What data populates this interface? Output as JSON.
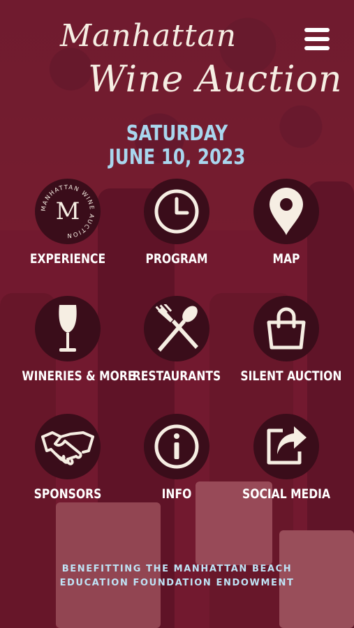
{
  "logo": {
    "line1": "Manhattan",
    "line2": "Wine Auction"
  },
  "event_date": {
    "weekday": "SATURDAY",
    "date": "JUNE 10, 2023"
  },
  "badge": {
    "ring_text": "MANHATTAN WINE AUCTION",
    "letter": "M"
  },
  "grid": [
    {
      "label": "EXPERIENCE",
      "icon": "wine-auction-badge-icon"
    },
    {
      "label": "PROGRAM",
      "icon": "clock-icon"
    },
    {
      "label": "MAP",
      "icon": "map-pin-icon"
    },
    {
      "label": "WINERIES & MORE",
      "icon": "wine-glass-icon"
    },
    {
      "label": "RESTAURANTS",
      "icon": "fork-spoon-icon"
    },
    {
      "label": "SILENT AUCTION",
      "icon": "shopping-bag-icon"
    },
    {
      "label": "SPONSORS",
      "icon": "handshake-icon"
    },
    {
      "label": "INFO",
      "icon": "info-icon"
    },
    {
      "label": "SOCIAL MEDIA",
      "icon": "share-icon"
    }
  ],
  "footer": {
    "line1": "BENEFITTING THE MANHATTAN BEACH",
    "line2": "EDUCATION FOUNDATION ENDOWMENT"
  },
  "colors": {
    "background": "#6e1a2e",
    "icon_circle": "#3a0d1a",
    "icon_fill": "#f6eee3",
    "date_text": "#a9d6ee",
    "footer_text": "#bfe3f5"
  }
}
